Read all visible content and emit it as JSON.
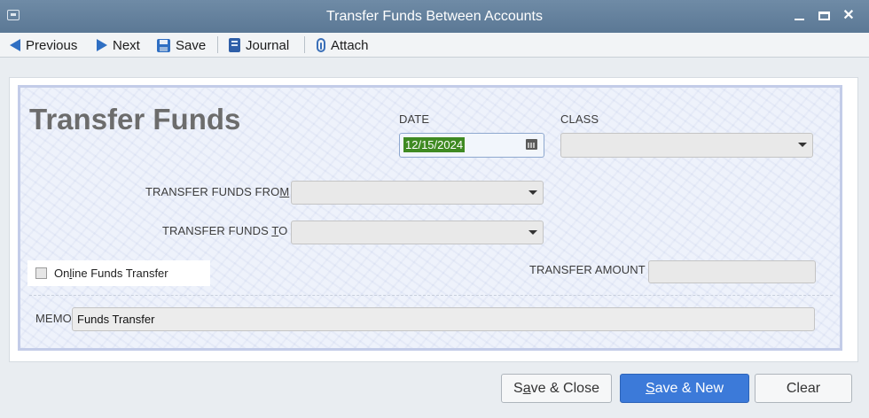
{
  "window": {
    "title": "Transfer Funds Between Accounts"
  },
  "toolbar": {
    "previous": "Previous",
    "next": "Next",
    "save": "Save",
    "journal": "Journal",
    "attach": "Attach"
  },
  "form": {
    "heading": "Transfer Funds",
    "date_label": "DATE",
    "date_value": "12/15/2024",
    "class_label": "CLASS",
    "class_value": "",
    "from_label": "TRANSFER FUNDS FRO",
    "from_label_accel": "M",
    "from_value": "",
    "to_label": "TRANSFER FUNDS ",
    "to_label_accel": "T",
    "to_label_rest": "O",
    "to_value": "",
    "online_label_pre": "On",
    "online_label_accel": "l",
    "online_label_post": "ine Funds Transfer",
    "online_checked": false,
    "amount_label": "TRANSFER AMOUNT",
    "amount_value": "",
    "memo_label": "MEMO",
    "memo_value": "Funds Transfer"
  },
  "buttons": {
    "save_close_pre": "S",
    "save_close_accel": "a",
    "save_close_post": "ve & Close",
    "save_new_pre": "",
    "save_new_accel": "S",
    "save_new_post": "ave & New",
    "clear": "Clear"
  },
  "colors": {
    "titlebar": "#5b7895",
    "primary_button": "#3c7ad9",
    "date_selection": "#3f8a22"
  }
}
